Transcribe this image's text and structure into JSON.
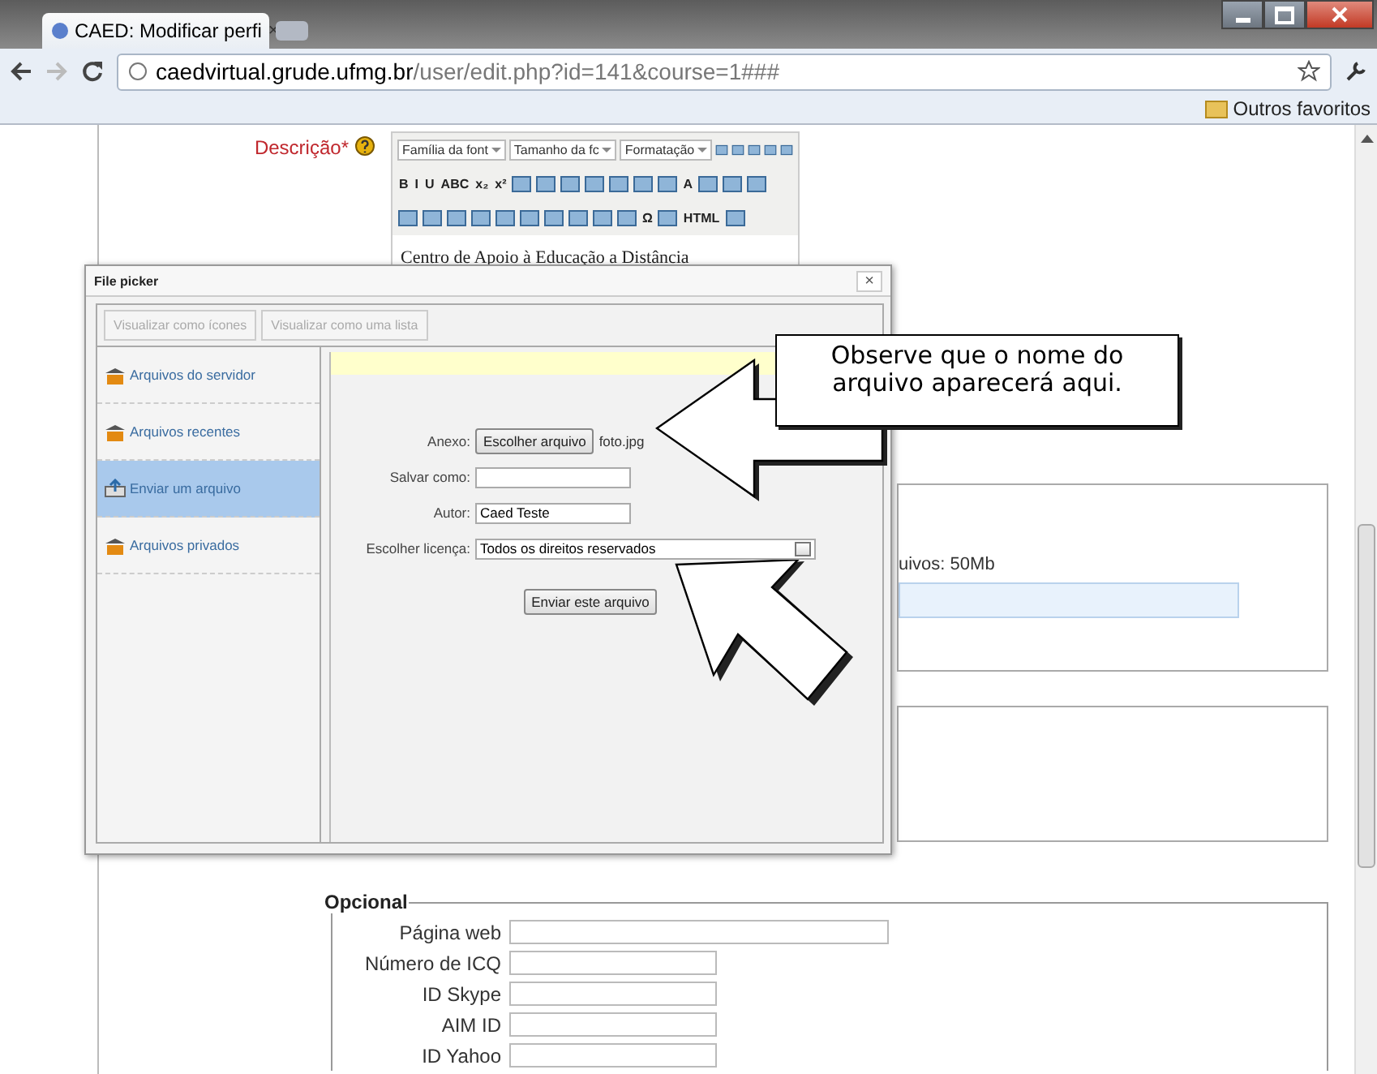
{
  "browser": {
    "tab_title": "CAED: Modificar perfi",
    "tab_close": "×",
    "url_host": "caedvirtual.grude.ufmg.br",
    "url_path": "/user/edit.php?id=141&course=1###",
    "bookmark": "Outros favoritos"
  },
  "description": {
    "label": "Descrição",
    "required": "*",
    "editor_rows": [
      [
        {
          "kind": "select",
          "label": "Família da font"
        },
        {
          "kind": "select",
          "label": "Tamanho da fc"
        },
        {
          "kind": "select",
          "label": "Formatação"
        },
        {
          "kind": "icon"
        },
        {
          "kind": "icon"
        },
        {
          "kind": "icon"
        },
        {
          "kind": "icon"
        },
        {
          "kind": "icon"
        }
      ],
      [
        {
          "kind": "glyph",
          "label": "B"
        },
        {
          "kind": "glyph",
          "label": "I"
        },
        {
          "kind": "glyph",
          "label": "U"
        },
        {
          "kind": "glyph",
          "label": "ABC"
        },
        {
          "kind": "glyph",
          "label": "x₂"
        },
        {
          "kind": "glyph",
          "label": "x²"
        },
        {
          "kind": "icon"
        },
        {
          "kind": "icon"
        },
        {
          "kind": "icon"
        },
        {
          "kind": "icon"
        },
        {
          "kind": "icon"
        },
        {
          "kind": "icon"
        },
        {
          "kind": "icon"
        },
        {
          "kind": "glyph",
          "label": "A"
        },
        {
          "kind": "icon"
        },
        {
          "kind": "icon"
        },
        {
          "kind": "icon"
        }
      ],
      [
        {
          "kind": "icon"
        },
        {
          "kind": "icon"
        },
        {
          "kind": "icon"
        },
        {
          "kind": "icon"
        },
        {
          "kind": "icon"
        },
        {
          "kind": "icon"
        },
        {
          "kind": "icon"
        },
        {
          "kind": "icon"
        },
        {
          "kind": "icon"
        },
        {
          "kind": "icon"
        },
        {
          "kind": "glyph",
          "label": "Ω"
        },
        {
          "kind": "icon"
        },
        {
          "kind": "glyph",
          "label": "HTML"
        },
        {
          "kind": "icon"
        }
      ]
    ],
    "content": "Centro de Apoio à Educação a Distância"
  },
  "upload_section": {
    "quota_text": "uivos: 50Mb"
  },
  "optional": {
    "legend": "Opcional",
    "fields": [
      {
        "label": "Página web",
        "wide": true
      },
      {
        "label": "Número de ICQ",
        "wide": false
      },
      {
        "label": "ID Skype",
        "wide": false
      },
      {
        "label": "AIM ID",
        "wide": false
      },
      {
        "label": "ID Yahoo",
        "wide": false
      }
    ]
  },
  "file_picker": {
    "title": "File picker",
    "close": "×",
    "view_buttons": [
      {
        "label": "Visualizar como ícones",
        "disabled": true
      },
      {
        "label": "Visualizar como uma lista",
        "disabled": true
      }
    ],
    "sources": [
      {
        "label": "Arquivos do servidor",
        "kind": "repo",
        "selected": false
      },
      {
        "label": "Arquivos recentes",
        "kind": "repo",
        "selected": false
      },
      {
        "label": "Enviar um arquivo",
        "kind": "upload",
        "selected": true
      },
      {
        "label": "Arquivos privados",
        "kind": "repo",
        "selected": false
      }
    ],
    "attachment_label": "Anexo:",
    "choose_button": "Escolher arquivo",
    "file_name": "foto.jpg",
    "save_as_label": "Salvar como:",
    "author_label": "Autor:",
    "author_value": "Caed Teste",
    "license_label": "Escolher licença:",
    "license_value": "Todos os direitos reservados",
    "submit": "Enviar este arquivo"
  },
  "callout": {
    "text": "Observe que o nome do arquivo aparecerá aqui."
  }
}
